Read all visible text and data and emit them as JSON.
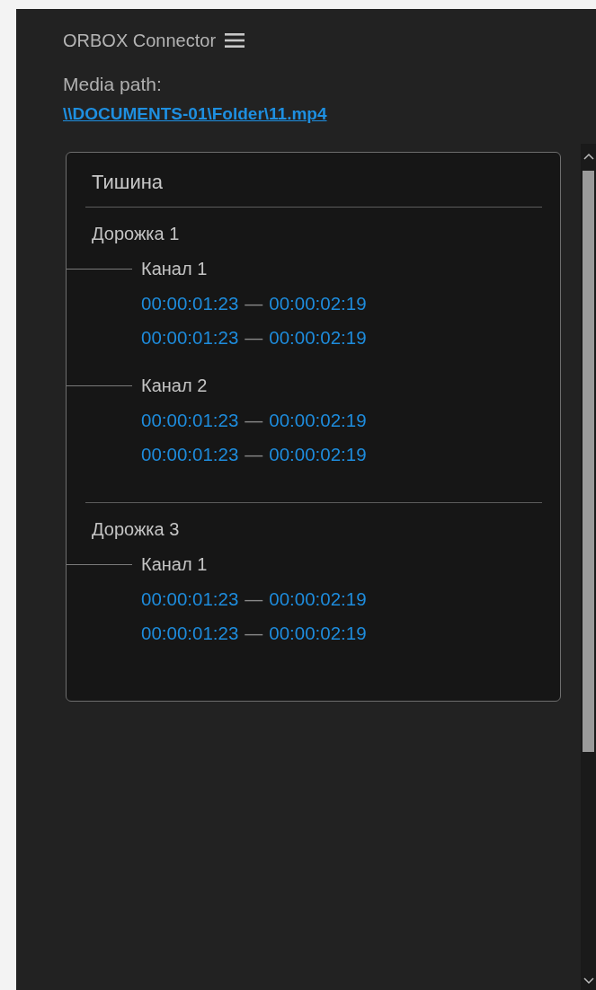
{
  "header": {
    "title": "ORBOX Connector"
  },
  "media": {
    "label": "Media path:",
    "path": "\\\\DOCUMENTS-01\\Folder\\11.mp4"
  },
  "card": {
    "title": "Тишина",
    "tracks": [
      {
        "name": "Дорожка 1",
        "channels": [
          {
            "name": "Канал 1",
            "ranges": [
              {
                "start": "00:00:01:23",
                "separator": "—",
                "end": "00:00:02:19"
              },
              {
                "start": "00:00:01:23",
                "separator": "—",
                "end": "00:00:02:19"
              }
            ]
          },
          {
            "name": "Канал 2",
            "ranges": [
              {
                "start": "00:00:01:23",
                "separator": "—",
                "end": "00:00:02:19"
              },
              {
                "start": "00:00:01:23",
                "separator": "—",
                "end": "00:00:02:19"
              }
            ]
          }
        ]
      },
      {
        "name": "Дорожка 3",
        "channels": [
          {
            "name": "Канал 1",
            "ranges": [
              {
                "start": "00:00:01:23",
                "separator": "—",
                "end": "00:00:02:19"
              },
              {
                "start": "00:00:01:23",
                "separator": "—",
                "end": "00:00:02:19"
              }
            ]
          }
        ]
      }
    ]
  }
}
